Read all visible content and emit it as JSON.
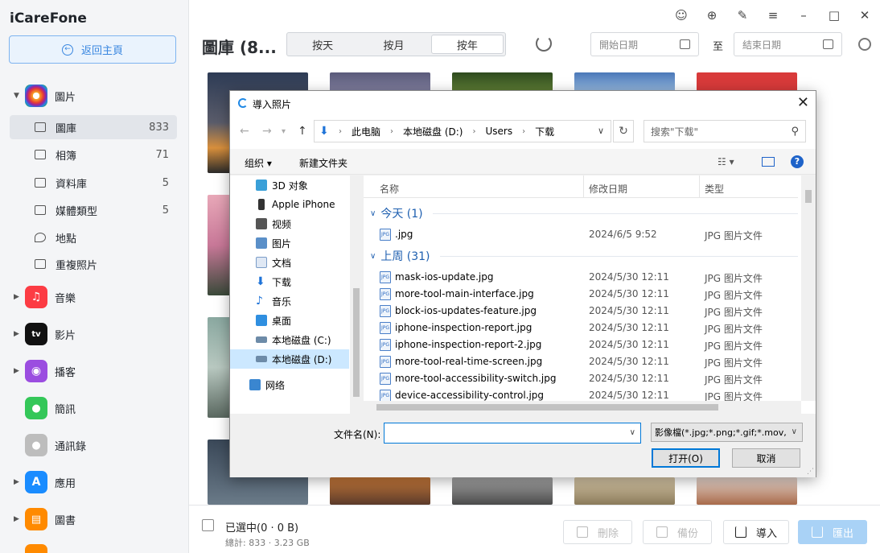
{
  "app": {
    "name": "iCareFone",
    "home_button": "返回主頁",
    "window_controls": [
      "user-icon",
      "download-icon",
      "feedback-icon",
      "menu-icon",
      "minimize-icon",
      "maximize-icon",
      "close-icon"
    ]
  },
  "sidebar": {
    "photos": {
      "label": "圖片",
      "icon": "photos-icon",
      "color": "#f4b400"
    },
    "photo_items": [
      {
        "label": "圖庫",
        "count": "833",
        "icon": "library-icon"
      },
      {
        "label": "相簿",
        "count": "71",
        "icon": "album-icon"
      },
      {
        "label": "資料庫",
        "count": "5",
        "icon": "database-icon"
      },
      {
        "label": "媒體類型",
        "count": "5",
        "icon": "media-type-icon"
      },
      {
        "label": "地點",
        "count": "",
        "icon": "location-icon"
      },
      {
        "label": "重複照片",
        "count": "",
        "icon": "duplicate-icon"
      }
    ],
    "sections": [
      {
        "label": "音樂",
        "icon": "music-icon",
        "color": "#fc3c44",
        "glyph": "♫"
      },
      {
        "label": "影片",
        "icon": "tv-icon",
        "color": "#111111",
        "glyph": "tv"
      },
      {
        "label": "播客",
        "icon": "podcast-icon",
        "color": "#9b4de0",
        "glyph": "◉"
      },
      {
        "label": "簡訊",
        "icon": "messages-icon",
        "color": "#34c759",
        "glyph": "💬"
      },
      {
        "label": "通訊錄",
        "icon": "contacts-icon",
        "color": "#a8a8a8",
        "glyph": "👤"
      },
      {
        "label": "應用",
        "icon": "appstore-icon",
        "color": "#1a8cff",
        "glyph": "A"
      },
      {
        "label": "圖書",
        "icon": "books-icon",
        "color": "#ff8a00",
        "glyph": "📖"
      }
    ]
  },
  "header": {
    "title": "圖庫 (8...",
    "segments": [
      "按天",
      "按月",
      "按年"
    ],
    "active_segment": "按年",
    "start_date_placeholder": "開始日期",
    "to_label": "至",
    "end_date_placeholder": "結束日期"
  },
  "bottom": {
    "selected_text": "已選中(0 · 0 B)",
    "total_text": "總計: 833 · 3.23 GB",
    "delete_label": "刪除",
    "backup_label": "備份",
    "import_label": "導入",
    "export_label": "匯出"
  },
  "dialog": {
    "title": "導入照片",
    "breadcrumb": [
      "此电脑",
      "本地磁盘 (D:)",
      "Users",
      "下载"
    ],
    "search_placeholder": "搜索\"下载\"",
    "organize_label": "组织 ▾",
    "new_folder_label": "新建文件夹",
    "nav_items": [
      {
        "label": "3D 对象",
        "icon": "3d-objects-icon",
        "color": "#3aa0d8"
      },
      {
        "label": "Apple iPhone",
        "icon": "iphone-icon",
        "color": "#333333"
      },
      {
        "label": "视频",
        "icon": "video-icon",
        "color": "#555555"
      },
      {
        "label": "图片",
        "icon": "pictures-icon",
        "color": "#5a8fc8"
      },
      {
        "label": "文档",
        "icon": "documents-icon",
        "color": "#7a9cc8"
      },
      {
        "label": "下载",
        "icon": "downloads-icon",
        "color": "#1e73d8"
      },
      {
        "label": "音乐",
        "icon": "music-folder-icon",
        "color": "#1e73d8"
      },
      {
        "label": "桌面",
        "icon": "desktop-icon",
        "color": "#2f8fe0"
      },
      {
        "label": "本地磁盘 (C:)",
        "icon": "disk-c-icon",
        "color": "#6d8ba8"
      },
      {
        "label": "本地磁盘 (D:)",
        "icon": "disk-d-icon",
        "color": "#6d8ba8"
      },
      {
        "label": "网络",
        "icon": "network-icon",
        "color": "#3a86d0"
      }
    ],
    "columns": {
      "name": "名称",
      "date": "修改日期",
      "type": "类型"
    },
    "groups": [
      {
        "label": "今天 (1)",
        "files": [
          {
            "name": ".jpg",
            "date": "2024/6/5 9:52",
            "type": "JPG 图片文件"
          }
        ]
      },
      {
        "label": "上周 (31)",
        "files": [
          {
            "name": "mask-ios-update.jpg",
            "date": "2024/5/30 12:11",
            "type": "JPG 图片文件"
          },
          {
            "name": "more-tool-main-interface.jpg",
            "date": "2024/5/30 12:11",
            "type": "JPG 图片文件"
          },
          {
            "name": "block-ios-updates-feature.jpg",
            "date": "2024/5/30 12:11",
            "type": "JPG 图片文件"
          },
          {
            "name": "iphone-inspection-report.jpg",
            "date": "2024/5/30 12:11",
            "type": "JPG 图片文件"
          },
          {
            "name": "iphone-inspection-report-2.jpg",
            "date": "2024/5/30 12:11",
            "type": "JPG 图片文件"
          },
          {
            "name": "more-tool-real-time-screen.jpg",
            "date": "2024/5/30 12:11",
            "type": "JPG 图片文件"
          },
          {
            "name": "more-tool-accessibility-switch.jpg",
            "date": "2024/5/30 12:11",
            "type": "JPG 图片文件"
          },
          {
            "name": "device-accessibility-control.jpg",
            "date": "2024/5/30 12:11",
            "type": "JPG 图片文件"
          }
        ]
      }
    ],
    "filename_label": "文件名(N):",
    "filename_value": "",
    "filetype_value": "影像檔(*.jpg;*.png;*.gif;*.mov,",
    "open_label": "打开(O)",
    "cancel_label": "取消"
  }
}
